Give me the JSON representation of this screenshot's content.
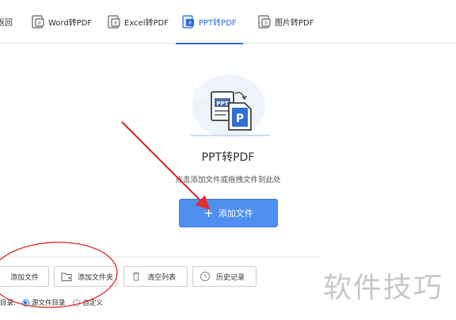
{
  "tabs": [
    {
      "label": "返回",
      "icon": "back-icon"
    },
    {
      "label": "Word转PDF",
      "icon": "word-file-icon"
    },
    {
      "label": "Excel转PDF",
      "icon": "excel-file-icon"
    },
    {
      "label": "PPT转PDF",
      "icon": "ppt-file-icon",
      "active": true
    },
    {
      "label": "图片转PDF",
      "icon": "image-file-icon"
    }
  ],
  "main": {
    "title": "PPT转PDF",
    "hint": "点击添加文件或拖拽文件到此处",
    "add_button": "添加文件",
    "illustration": {
      "ppt_label": "PPT",
      "pdf_label": "P"
    }
  },
  "toolbar": {
    "add_file": "添加文件",
    "add_folder": "添加文件夹",
    "clear_list": "清空列表",
    "history": "历史记录"
  },
  "output": {
    "label": "目录:",
    "option_source": "源文件目录",
    "option_custom": "自定义",
    "selected": "源文件目录"
  },
  "watermark": "软件技巧",
  "colors": {
    "accent": "#2f6fd6",
    "primary_button": "#4f8ff0",
    "annotation_red": "#e03030"
  }
}
